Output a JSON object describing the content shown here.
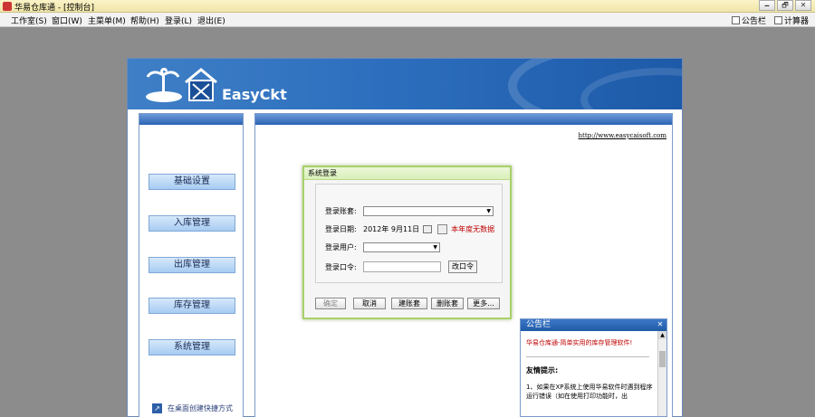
{
  "window": {
    "title": "华易仓库通 - [控制台]",
    "buttons": [
      "🗕",
      "🗗",
      "✕"
    ]
  },
  "menu": {
    "items": [
      "工作室(S)",
      "窗口(W)",
      "主菜单(M)",
      "帮助(H)",
      "登录(L)",
      "退出(E)"
    ],
    "right": [
      "公告栏",
      "计算器"
    ]
  },
  "brand": {
    "name": "EasyCkt"
  },
  "nav": {
    "items": [
      "基础设置",
      "入库管理",
      "出库管理",
      "库存管理",
      "系统管理"
    ],
    "shortcut": "在桌面创建快捷方式"
  },
  "main": {
    "link": "http://www.easycaisoft.com"
  },
  "login_dialog": {
    "title": "系统登录",
    "fields": {
      "account_label": "登录账套:",
      "date_label": "登录日期:",
      "date_value": "2012年 9月11日",
      "date_warning": "本年度无数据",
      "user_label": "登录用户:",
      "password_label": "登录口令:",
      "change_password": "改口令"
    },
    "buttons": [
      "确定",
      "取消",
      "建账套",
      "删账套",
      "更多..."
    ]
  },
  "notice": {
    "title": "公告栏",
    "close": "✕",
    "slogan": "华易仓库通-简单实用的库存管理软件!",
    "tips_title": "友情提示:",
    "tips_text": "1、如果在XP系统上使用华易软件时遇到程序运行错误（如在使用打印功能时，出"
  }
}
